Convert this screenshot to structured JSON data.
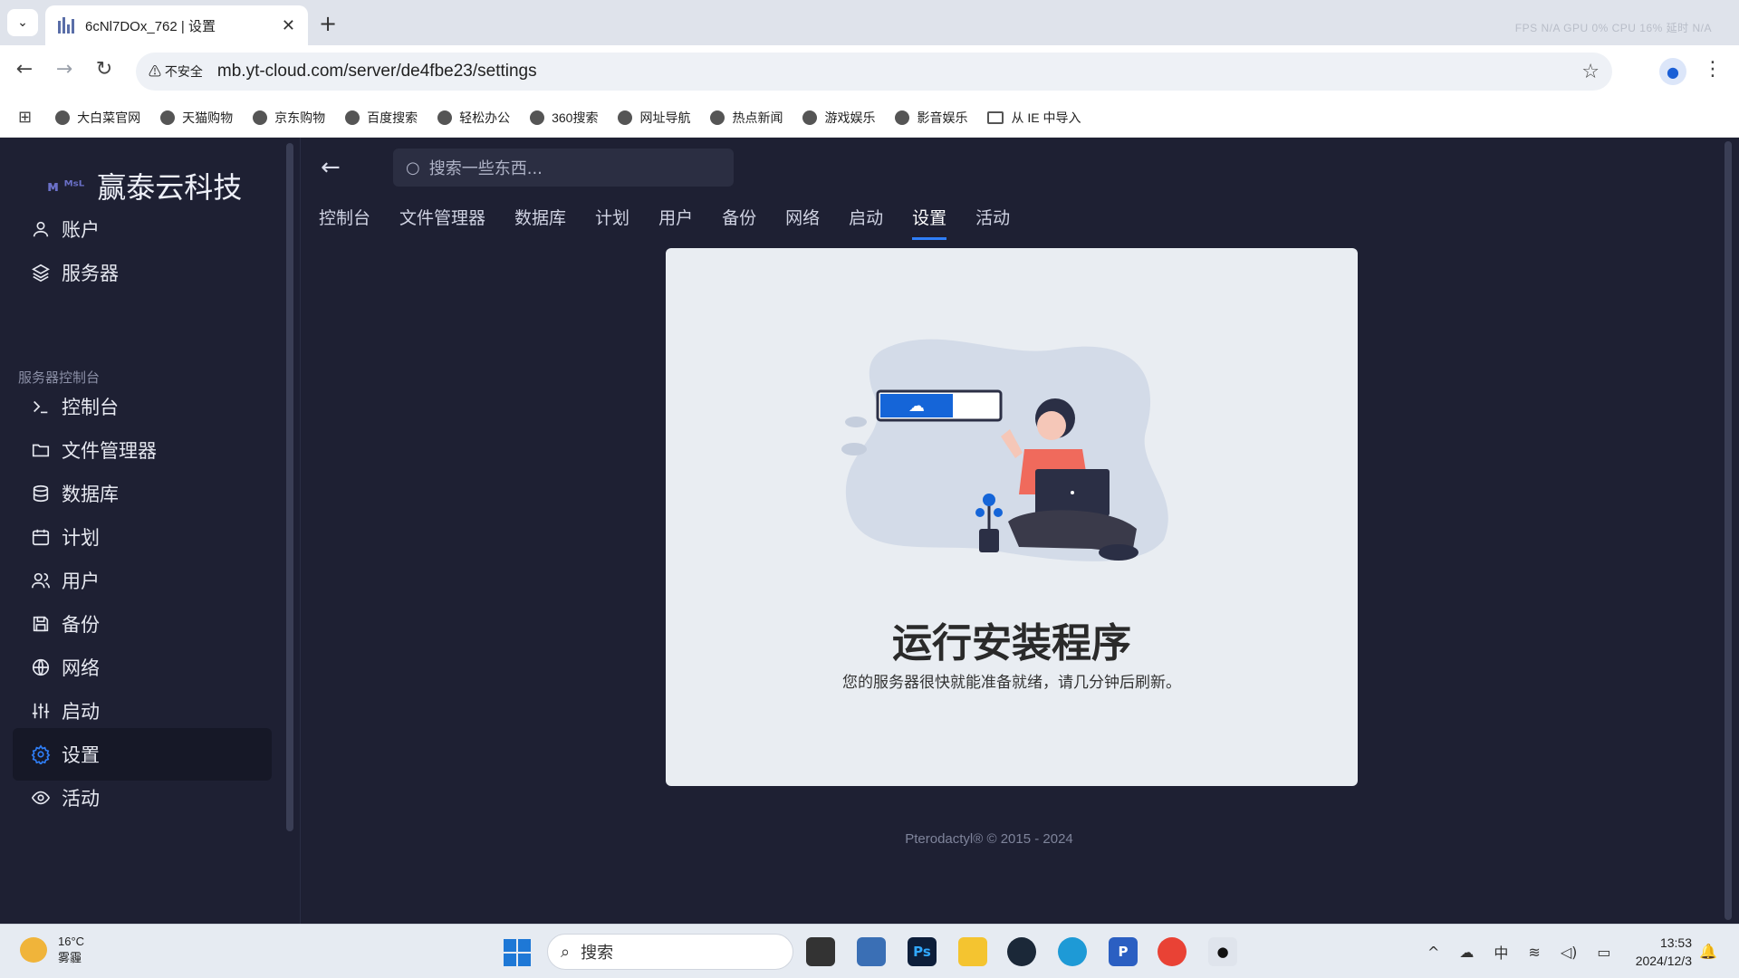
{
  "browser": {
    "tab_title": "6cNl7DOx_762 | 设置",
    "new_tab": "+",
    "sys_stats": "FPS N/A GPU 0% CPU 16% 延时 N/A",
    "security_label": "不安全",
    "url": "mb.yt-cloud.com/server/de4fbe23/settings",
    "bookmarks": [
      "大白菜官网",
      "天猫购物",
      "京东购物",
      "百度搜索",
      "轻松办公",
      "360搜索",
      "网址导航",
      "热点新闻",
      "游戏娱乐",
      "影音娱乐"
    ],
    "bookmark_folder": "从 IE 中导入"
  },
  "sidebar": {
    "brand_logo": "ᴍ ᴹˢᴸ",
    "brand_name": "赢泰云科技",
    "top_items": [
      {
        "label": "账户",
        "icon": "user-icon"
      },
      {
        "label": "服务器",
        "icon": "layers-icon"
      }
    ],
    "section_label": "服务器控制台",
    "items": [
      {
        "label": "控制台",
        "icon": "terminal-icon"
      },
      {
        "label": "文件管理器",
        "icon": "folder-icon"
      },
      {
        "label": "数据库",
        "icon": "database-icon"
      },
      {
        "label": "计划",
        "icon": "calendar-icon"
      },
      {
        "label": "用户",
        "icon": "users-icon"
      },
      {
        "label": "备份",
        "icon": "save-icon"
      },
      {
        "label": "网络",
        "icon": "globe-icon"
      },
      {
        "label": "启动",
        "icon": "sliders-icon"
      },
      {
        "label": "设置",
        "icon": "gear-icon",
        "active": true
      },
      {
        "label": "活动",
        "icon": "eye-icon"
      }
    ]
  },
  "main": {
    "search_placeholder": "搜索一些东西...",
    "tabs": [
      "控制台",
      "文件管理器",
      "数据库",
      "计划",
      "用户",
      "备份",
      "网络",
      "启动",
      "设置",
      "活动"
    ],
    "active_tab": "设置",
    "card_title": "运行安装程序",
    "card_subtitle": "您的服务器很快就能准备就绪，请几分钟后刷新。",
    "footer": "Pterodactyl® © 2015 - 2024"
  },
  "taskbar": {
    "weather_temp": "16°C",
    "weather_desc": "雾霾",
    "search_label": "搜索",
    "ime": "中",
    "time": "13:53",
    "date": "2024/12/3"
  },
  "colors": {
    "sidebar_bg": "#1e2033",
    "accent": "#2f7ef7",
    "card_bg": "#e9edf2"
  }
}
